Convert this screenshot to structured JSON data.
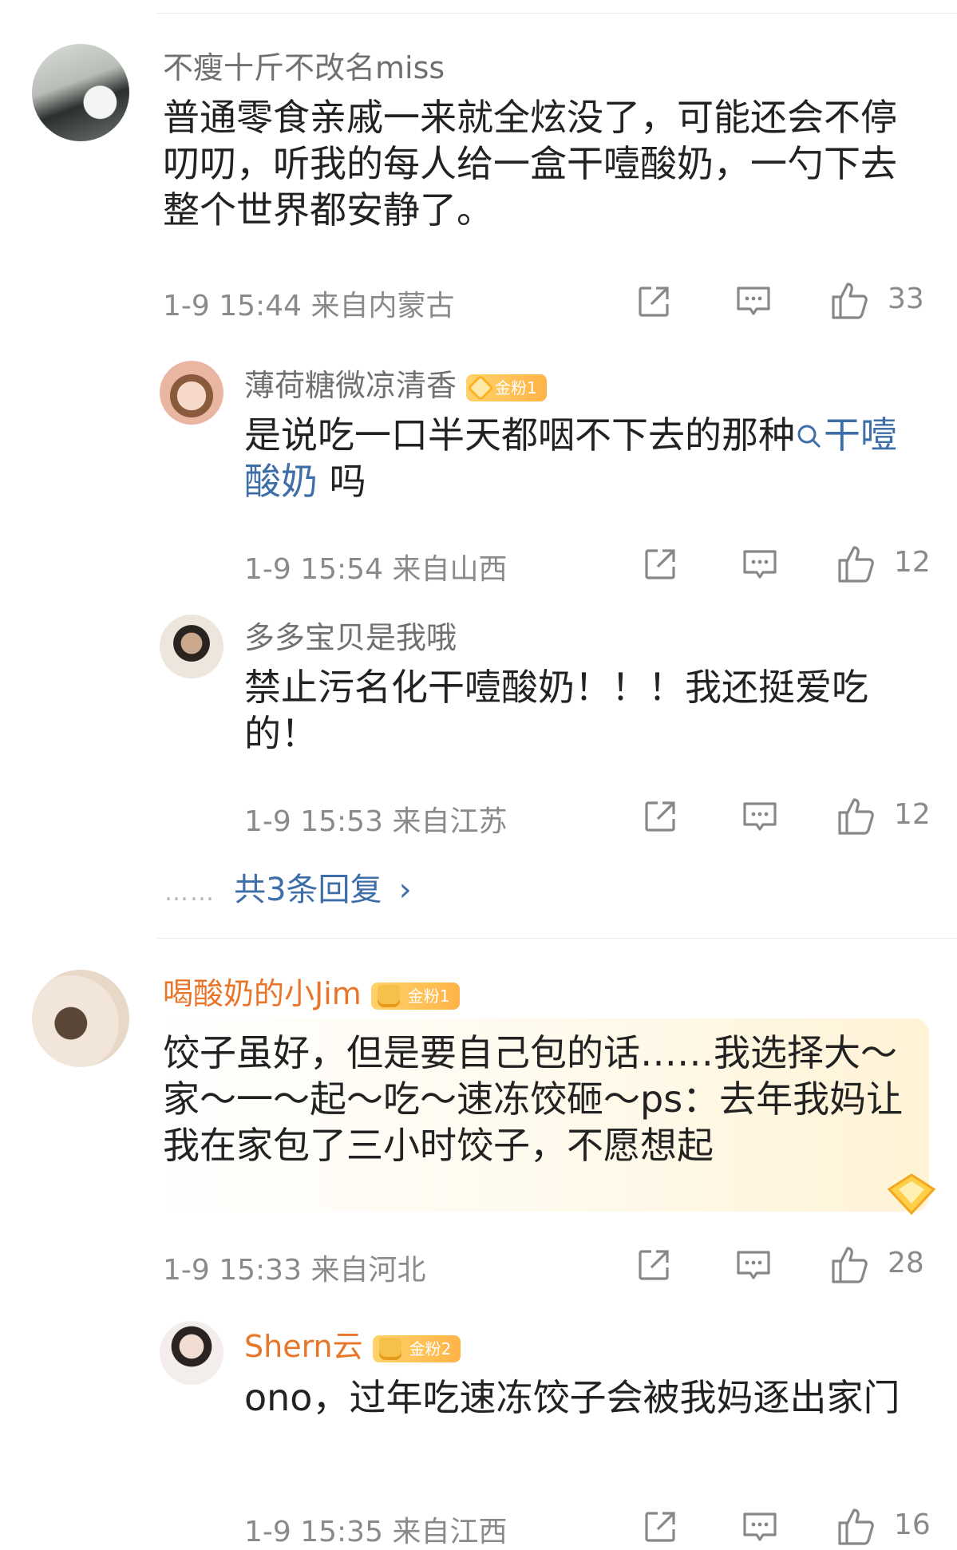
{
  "comments": [
    {
      "username": "不瘦十斤不改名miss",
      "text": "普通零食亲戚一来就全炫没了，可能还会不停叨叨，听我的每人给一盒干噎酸奶，一勺下去整个世界都安静了。",
      "time": "1-9 15:44",
      "location": "来自内蒙古",
      "likes": "33"
    },
    {
      "username": "喝酸奶的小Jim",
      "badge": "金粉1",
      "text": "饺子虽好，但是要自己包的话……我选择大～家～一～起～吃～速冻饺砸～ps：去年我妈让我在家包了三小时饺子，不愿想起",
      "time": "1-9 15:33",
      "location": "来自河北",
      "likes": "28"
    }
  ],
  "replies": [
    {
      "username": "薄荷糖微凉清香",
      "badge": "金粉1",
      "text_before": "是说吃一口半天都咽不下去的那种",
      "search_icon": "search-icon",
      "link_text": "干噎酸奶",
      "text_after": " 吗",
      "time": "1-9 15:54",
      "location": "来自山西",
      "likes": "12"
    },
    {
      "username": "多多宝贝是我哦",
      "text": "禁止污名化干噎酸奶！！！我还挺爱吃的！",
      "time": "1-9 15:53",
      "location": "来自江苏",
      "likes": "12"
    },
    {
      "username": "Shern云",
      "badge": "金粉2",
      "text": "ono，过年吃速冻饺子会被我妈逐出家门",
      "time": "1-9 15:35",
      "location": "来自江西",
      "likes": "16"
    }
  ],
  "more_replies": {
    "dots": "……",
    "label": "共3条回复",
    "chevron": "›"
  },
  "icons": {
    "share": "share-icon",
    "comment": "comment-icon",
    "like": "thumbs-up-icon"
  },
  "colors": {
    "link": "#3d6ea8",
    "vip_name": "#e8762a",
    "badge": "#ffb347"
  }
}
